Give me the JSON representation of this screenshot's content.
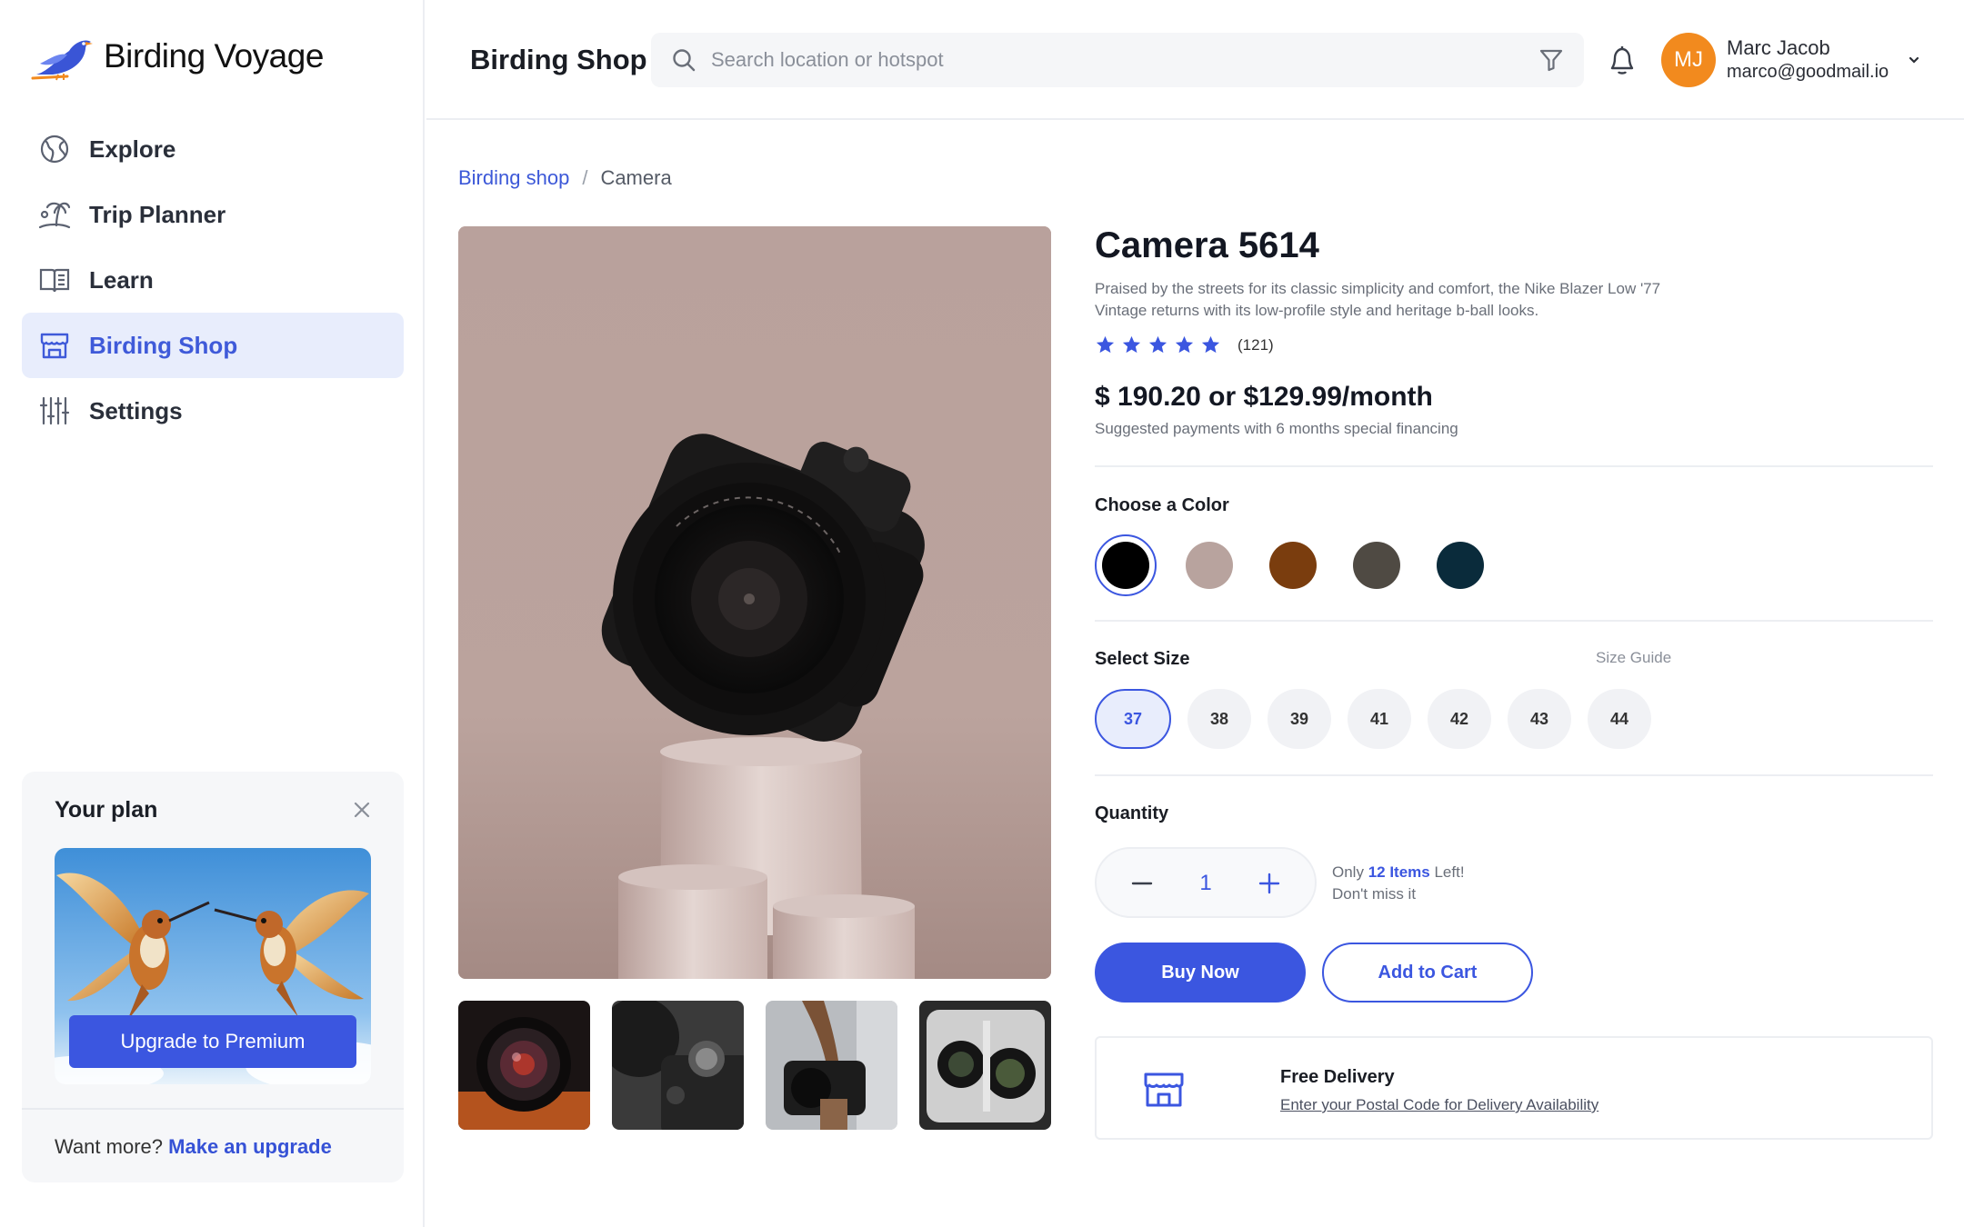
{
  "app": {
    "name": "Birding Voyage"
  },
  "sidebar": {
    "items": [
      {
        "label": "Explore",
        "icon": "globe-icon",
        "active": false
      },
      {
        "label": "Trip Planner",
        "icon": "palm-tree-icon",
        "active": false
      },
      {
        "label": "Learn",
        "icon": "book-icon",
        "active": false
      },
      {
        "label": "Birding Shop",
        "icon": "store-icon",
        "active": true
      },
      {
        "label": "Settings",
        "icon": "sliders-icon",
        "active": false
      }
    ]
  },
  "plan": {
    "title": "Your plan",
    "upgrade_label": "Upgrade to  Premium",
    "more_text": "Want more?",
    "more_link": "Make an upgrade"
  },
  "header": {
    "title": "Birding Shop",
    "search_placeholder": "Search location or hotspot",
    "user": {
      "initials": "MJ",
      "name": "Marc Jacob",
      "email": "marco@goodmail.io"
    }
  },
  "breadcrumb": {
    "parent": "Birding shop",
    "separator": "/",
    "current": "Camera"
  },
  "product": {
    "title": "Camera 5614",
    "description": "Praised by the streets for its classic simplicity and comfort, the Nike Blazer Low '77 Vintage returns with its low-profile style and heritage b-ball looks.",
    "rating": 5,
    "review_count": "(121)",
    "price": "$ 190.20 or $129.99/month",
    "price_note": "Suggested payments with 6 months special financing",
    "color_label": "Choose a Color",
    "colors": [
      "#000000",
      "#b8a39e",
      "#7a3d0e",
      "#4f4a43",
      "#0a2b3b"
    ],
    "selected_color": 0,
    "size_label": "Select Size",
    "size_guide": "Size Guide",
    "sizes": [
      "37",
      "38",
      "39",
      "41",
      "42",
      "43",
      "44"
    ],
    "selected_size": "37",
    "quantity_label": "Quantity",
    "quantity": "1",
    "stock_pre": "Only ",
    "stock_count": "12 Items",
    "stock_post": " Left!",
    "stock_note": "Don't miss it",
    "buy_label": "Buy Now",
    "cart_label": "Add to Cart",
    "delivery_title": "Free Delivery",
    "delivery_link": "Enter your Postal Code for Delivery Availability"
  },
  "colors": {
    "accent": "#3b56e0",
    "avatar": "#f28a1e",
    "active_nav_bg": "#e8edfc"
  }
}
